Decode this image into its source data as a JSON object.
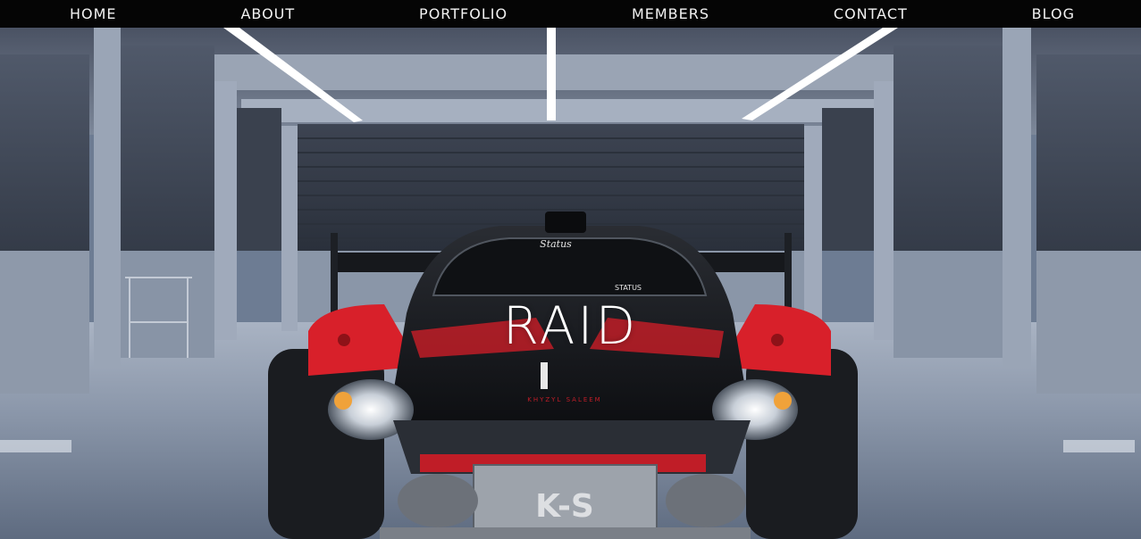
{
  "nav": {
    "items": [
      {
        "label": "HOME"
      },
      {
        "label": "ABOUT"
      },
      {
        "label": "PORTFOLIO"
      },
      {
        "label": "MEMBERS"
      },
      {
        "label": "CONTACT"
      },
      {
        "label": "BLOG"
      }
    ]
  },
  "hero": {
    "title": "RAID",
    "image": "garage-race-car-photo",
    "car_text": {
      "windshield_logo": "Status",
      "windshield_badge": "STATUS",
      "hood_text": "KHYZYL SALEEM",
      "plate_text": "K-S"
    }
  },
  "colors": {
    "nav_bg": "#050505",
    "nav_text": "#f2f2f2",
    "accent_red": "#d8202a"
  }
}
